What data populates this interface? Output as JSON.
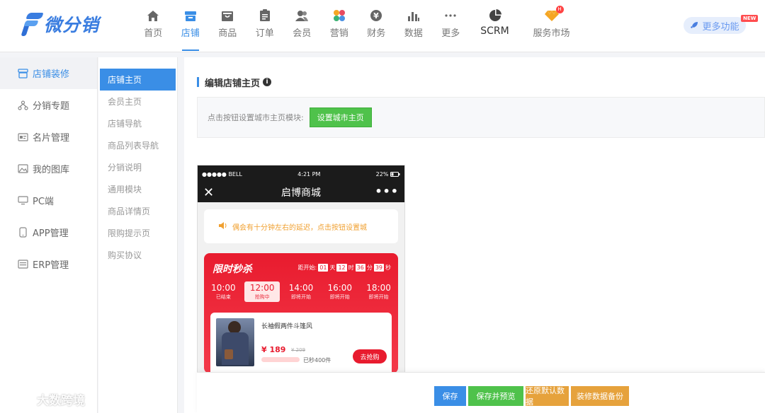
{
  "brand": {
    "name": "微分销",
    "color": "#3a7de0"
  },
  "nav": {
    "items": [
      {
        "label": "首页",
        "icon": "home-icon"
      },
      {
        "label": "店铺",
        "icon": "store-icon",
        "active": true
      },
      {
        "label": "商品",
        "icon": "box-icon"
      },
      {
        "label": "订单",
        "icon": "clipboard-icon"
      },
      {
        "label": "会员",
        "icon": "users-icon"
      },
      {
        "label": "营销",
        "icon": "petals-icon"
      },
      {
        "label": "财务",
        "icon": "yen-icon"
      },
      {
        "label": "数据",
        "icon": "bar-chart-icon"
      },
      {
        "label": "更多",
        "icon": "ellipsis-icon"
      },
      {
        "label": "SCRM",
        "icon": "pie-icon"
      },
      {
        "label": "服务市场",
        "icon": "diamond-icon",
        "badge": "H"
      }
    ],
    "more_features": "更多功能",
    "new_badge": "NEW"
  },
  "sidebar": {
    "items": [
      {
        "label": "店铺装修",
        "icon": "shop-decor-icon",
        "active": true
      },
      {
        "label": "分销专题",
        "icon": "distribution-icon"
      },
      {
        "label": "名片管理",
        "icon": "card-icon"
      },
      {
        "label": "我的图库",
        "icon": "image-icon"
      },
      {
        "label": "PC端",
        "icon": "monitor-icon"
      },
      {
        "label": "APP管理",
        "icon": "phone-icon"
      },
      {
        "label": "ERP管理",
        "icon": "erp-icon"
      }
    ]
  },
  "subsidebar": {
    "items": [
      {
        "label": "店铺主页",
        "active": true
      },
      {
        "label": "会员主页"
      },
      {
        "label": "店铺导航"
      },
      {
        "label": "商品列表导航"
      },
      {
        "label": "分销说明"
      },
      {
        "label": "通用模块"
      },
      {
        "label": "商品详情页"
      },
      {
        "label": "限购提示页"
      },
      {
        "label": "购买协议"
      }
    ]
  },
  "main": {
    "title": "编辑店铺主页",
    "info_glyph": "i",
    "notice": "点击按钮设置城市主页模块:",
    "set_city_button": "设置城市主页"
  },
  "phone": {
    "carrier": "●●●●● BELL",
    "time": "4:21 PM",
    "battery": "22%",
    "store_name": "启博商城",
    "notice": "偶会有十分钟左右的延迟，点击按钮设置城",
    "flash_sale": {
      "title": "限时秒杀",
      "countdown_prefix": "距开始:",
      "days": "01",
      "days_unit": "天",
      "hours": "12",
      "hours_unit": "时",
      "minutes": "36",
      "minutes_unit": "分",
      "seconds": "39",
      "seconds_unit": "秒",
      "slots": [
        {
          "time": "10:00",
          "status": "已结束"
        },
        {
          "time": "12:00",
          "status": "抢购中",
          "active": true
        },
        {
          "time": "14:00",
          "status": "即将开始"
        },
        {
          "time": "16:00",
          "status": "即将开始"
        },
        {
          "time": "18:00",
          "status": "即将开始"
        }
      ],
      "product": {
        "name": "长袖假两件斗篷风",
        "price": "¥ 189",
        "original_price": "¥ 209",
        "sold": "已秒400件",
        "buy_button": "去抢购"
      }
    }
  },
  "actions": {
    "save": "保存",
    "save_preview": "保存并预览",
    "restore": "还原默认数据",
    "backup": "装修数据备份"
  },
  "watermark": "大数跨境"
}
